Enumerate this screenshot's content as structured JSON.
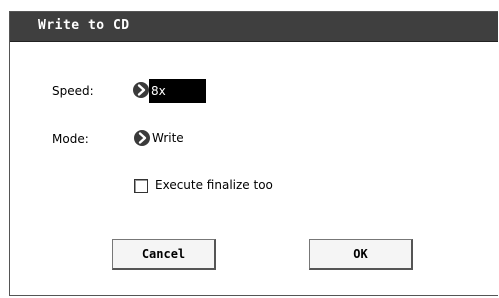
{
  "dialog": {
    "title": "Write to CD"
  },
  "fields": {
    "speed_label": "Speed:",
    "speed_value": "8x",
    "mode_label": "Mode:",
    "mode_value": "Write",
    "finalize_label": "Execute finalize too",
    "finalize_checked": false
  },
  "buttons": {
    "cancel_label": "Cancel",
    "ok_label": "OK"
  },
  "colors": {
    "titlebar": "#3f3f3f",
    "field_active_bg": "#000000"
  }
}
